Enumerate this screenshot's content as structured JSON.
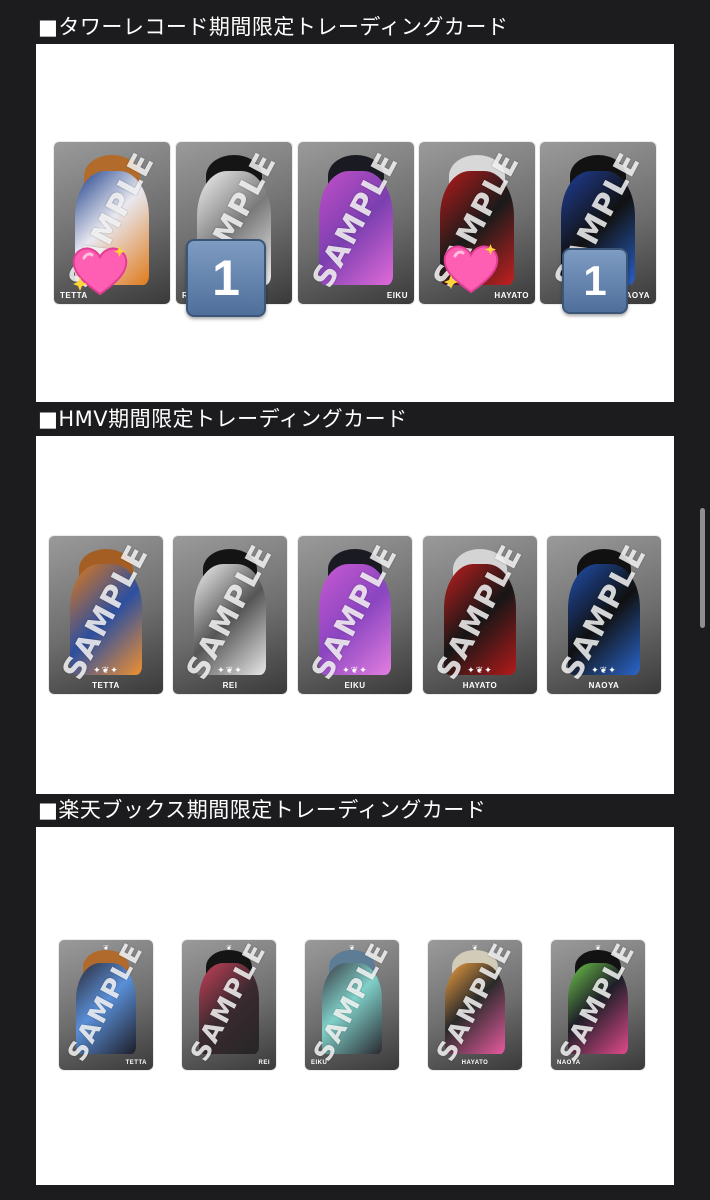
{
  "sections": [
    {
      "title": "■タワーレコード期間限定トレーディングカード",
      "cards": [
        {
          "name": "TETTA",
          "sticker": "heart"
        },
        {
          "name": "REI",
          "sticker": "keycap-1"
        },
        {
          "name": "EIKU",
          "sticker": ""
        },
        {
          "name": "HAYATO",
          "sticker": "heart"
        },
        {
          "name": "NAOYA",
          "sticker": "keycap-1"
        }
      ]
    },
    {
      "title": "■HMV期間限定トレーディングカード",
      "cards": [
        {
          "name": "TETTA"
        },
        {
          "name": "REI"
        },
        {
          "name": "EIKU"
        },
        {
          "name": "HAYATO"
        },
        {
          "name": "NAOYA"
        }
      ]
    },
    {
      "title": "■楽天ブックス期間限定トレーディングカード",
      "cards": [
        {
          "name": "TETTA"
        },
        {
          "name": "REI"
        },
        {
          "name": "EIKU"
        },
        {
          "name": "HAYATO"
        },
        {
          "name": "NAOYA"
        }
      ]
    }
  ],
  "watermark": "SAMPLE",
  "stickers": {
    "keycap_text": "1",
    "heart_icon": "sparkling-heart-icon",
    "keycap_icon": "keycap-one-icon"
  },
  "colors": {
    "background": "#1c1c1e",
    "panel": "#ffffff",
    "heading_text": "#ffffff",
    "keycap": "#5f7fab"
  }
}
